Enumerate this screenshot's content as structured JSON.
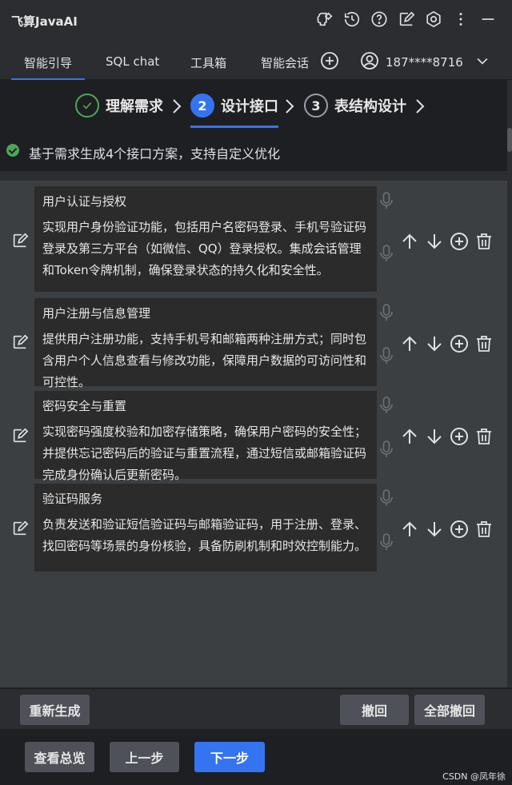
{
  "app": {
    "title": "飞算JavaAI"
  },
  "title_icons": [
    "brain-icon",
    "history-icon",
    "help-icon",
    "edit-icon",
    "settings-icon",
    "more-icon",
    "minimize-icon"
  ],
  "tabs": [
    {
      "label": "智能引导",
      "active": true
    },
    {
      "label": "SQL chat",
      "active": false
    },
    {
      "label": "工具箱",
      "active": false
    },
    {
      "label": "智能会话",
      "active": false
    }
  ],
  "user": {
    "phone": "187****8716"
  },
  "steps": [
    {
      "num": "",
      "label": "理解需求",
      "state": "done"
    },
    {
      "num": "2",
      "label": "设计接口",
      "state": "current"
    },
    {
      "num": "3",
      "label": "表结构设计",
      "state": "todo"
    }
  ],
  "status": {
    "text": "基于需求生成4个接口方案，支持自定义优化"
  },
  "interfaces": [
    {
      "title": "用户认证与授权",
      "desc": "实现用户身份验证功能，包括用户名密码登录、手机号验证码登录及第三方平台（如微信、QQ）登录授权。集成会话管理和Token令牌机制，确保登录状态的持久化和安全性。"
    },
    {
      "title": "用户注册与信息管理",
      "desc": "提供用户注册功能，支持手机号和邮箱两种注册方式；同时包含用户个人信息查看与修改功能，保障用户数据的可访问性和可控性。"
    },
    {
      "title": "密码安全与重置",
      "desc": "实现密码强度校验和加密存储策略，确保用户密码的安全性；并提供忘记密码后的验证与重置流程，通过短信或邮箱验证码完成身份确认后更新密码。"
    },
    {
      "title": "验证码服务",
      "desc": "负责发送和验证短信验证码与邮箱验证码，用于注册、登录、找回密码等场景的身份核验，具备防刷机制和时效控制能力。"
    }
  ],
  "actions": {
    "regenerate": "重新生成",
    "undo": "撤回",
    "undo_all": "全部撤回",
    "overview": "查看总览",
    "prev": "上一步",
    "next": "下一步"
  },
  "watermark": "CSDN @凤年徐",
  "colors": {
    "accent": "#3574f0",
    "success": "#4fa45a"
  }
}
